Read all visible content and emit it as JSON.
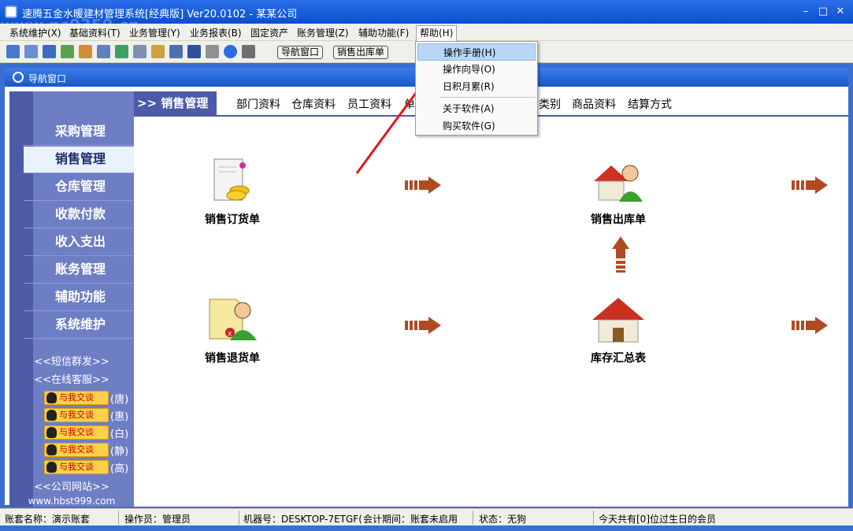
{
  "window": {
    "title": "速腾五金水暖建材管理系统[经典版] Ver20.0102 - 某某公司"
  },
  "menubar": {
    "items": [
      "系统维护(X)",
      "基础资料(T)",
      "业务管理(Y)",
      "业务报表(B)",
      "固定资产",
      "账务管理(Z)",
      "辅助功能(F)",
      "帮助(H)"
    ]
  },
  "toolbar": {
    "nav_button": "导航窗口",
    "sales_out_button": "销售出库单"
  },
  "help_menu": {
    "items": [
      "操作手册(H)",
      "操作向导(O)",
      "日积月累(R)",
      "关于软件(A)",
      "购买软件(G)"
    ]
  },
  "nav_window": {
    "title": "导航窗口"
  },
  "sidebar": {
    "items": [
      "采购管理",
      "销售管理",
      "仓库管理",
      "收款付款",
      "收入支出",
      "账务管理",
      "辅助功能",
      "系统维护"
    ],
    "active": "销售管理",
    "sms": "<<短信群发>>",
    "online_service": "<<在线客服>>",
    "qq_label": "与我交谈",
    "qq_names": [
      "(唐)",
      "(惠)",
      "(白)",
      "(静)",
      "(高)"
    ],
    "website": "<<公司网站>>",
    "url": "www.hbst999.com"
  },
  "tabs": {
    "active": ">> 销售管理",
    "links": [
      "部门资料",
      "仓库资料",
      "员工资料",
      "单",
      "类别",
      "商品资料",
      "结算方式"
    ]
  },
  "flow": {
    "sales_order": "销售订货单",
    "sales_out": "销售出库单",
    "sales_return": "销售退货单",
    "stock_summary": "库存汇总表"
  },
  "statusbar": {
    "account": "账套名称：演示账套",
    "operator": "操作员：管理员",
    "machine": "机器号：DESKTOP-7ETGF(",
    "period": "会计期间：账套未启用",
    "state": "状态：无狗",
    "birthday": "今天共有[0]位过生日的会员"
  },
  "watermark": "www.pc0359.cn"
}
